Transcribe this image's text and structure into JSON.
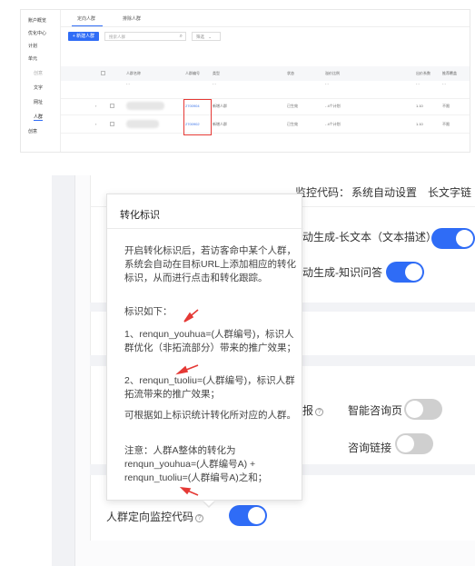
{
  "top": {
    "nav": [
      "账户概览",
      "优化中心",
      "计划",
      "单元",
      "创意",
      "文字",
      "网址",
      "人群",
      "创意"
    ],
    "tabs": [
      "定向人群",
      "排除人群"
    ],
    "new_button": "+ 新建人群",
    "search_placeholder": "搜索人群",
    "filter": "筛选",
    "headers": [
      "人群名称",
      "人群编号",
      "类型",
      "状态",
      "溢价比例",
      "出价系数",
      "推荐覆盖"
    ],
    "rows": [
      {
        "id": "",
        "type": "- -",
        "status": "",
        "premium": "- -",
        "bid": "- -",
        "coverage": "- -"
      },
      {
        "id": "2700904",
        "type": "新增人群",
        "status": "已生效",
        "premium": "- 4个计划",
        "bid": "1.10",
        "coverage": "不限"
      },
      {
        "id": "2700902",
        "type": "新增人群",
        "status": "已生效",
        "premium": "- 4个计划",
        "bid": "1.10",
        "coverage": "不限"
      }
    ]
  },
  "bottom": {
    "monitor_label": "监控代码：",
    "monitor_value": "系统自动设置",
    "long_text_tab": "长文字链",
    "row1_label": "动生成-长文本（文本描述）",
    "row2_label": "动生成-知识问答",
    "report_label": "报",
    "smart_label": "智能咨询页",
    "consult_label": "咨询链接",
    "crowd_label": "人群定向监控代码"
  },
  "tooltip": {
    "title": "转化标识",
    "p1": "开启转化标识后，若访客命中某个人群，系统会自动在目标URL上添加相应的转化标识，从而进行点击和转化跟踪。",
    "p2": "标识如下：",
    "p3": "1、renqun_youhua=(人群编号)，标识人群优化（非拓流部分）带来的推广效果；",
    "p4": "2、renqun_tuoliu=(人群编号)，标识人群拓流带来的推广效果；",
    "p5": "可根据如上标识统计转化所对应的人群。",
    "p6": "注意：人群A整体的转化为renqun_youhua=(人群编号A) + renqun_tuoliu=(人群编号A)之和；"
  },
  "colors": {
    "accent": "#2f6cf6",
    "annotation": "#e53935"
  }
}
